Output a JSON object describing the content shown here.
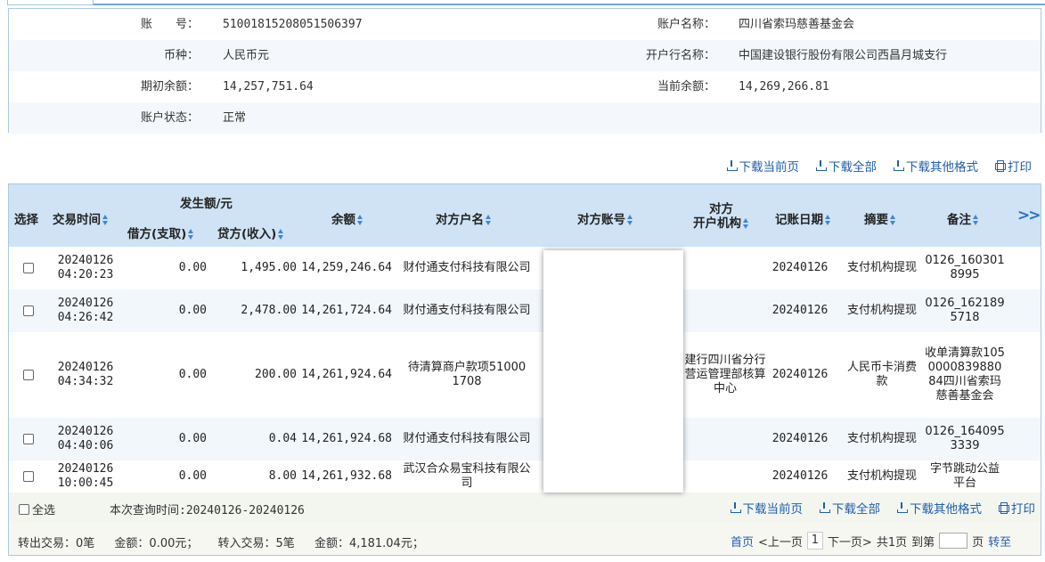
{
  "account": {
    "number_label": "账　　号：",
    "number": "51001815208051506397",
    "name_label": "账户名称：",
    "name": "四川省索玛慈善基金会",
    "currency_label": "币种：",
    "currency": "人民币元",
    "bank_label": "开户行名称：",
    "bank": "中国建设银行股份有限公司西昌月城支行",
    "opening_balance_label": "期初余额：",
    "opening_balance": "14,257,751.64",
    "current_balance_label": "当前余额：",
    "current_balance": "14,269,266.81",
    "status_label": "账户状态：",
    "status": "正常"
  },
  "actions": {
    "download_page": "下载当前页",
    "download_all": "下载全部",
    "download_other": "下载其他格式",
    "print": "打印"
  },
  "table": {
    "headers": {
      "select": "选择",
      "time": "交易时间",
      "amount_group": "发生额/元",
      "debit": "借方(支取)",
      "credit": "贷方(收入)",
      "balance": "余额",
      "counterparty_name": "对方户名",
      "counterparty_account": "对方账号",
      "counterparty_bank_line1": "对方",
      "counterparty_bank_line2": "开户机构",
      "post_date": "记账日期",
      "summary": "摘要",
      "remark": "备注",
      "more": ">>"
    },
    "rows": [
      {
        "date": "20240126",
        "time": "04:20:23",
        "debit": "0.00",
        "credit": "1,495.00",
        "balance": "14,259,246.64",
        "name": "财付通支付科技有限公司",
        "bank": "",
        "post": "20240126",
        "summary": "支付机构提现",
        "remark": "0126_1603018995"
      },
      {
        "date": "20240126",
        "time": "04:26:42",
        "debit": "0.00",
        "credit": "2,478.00",
        "balance": "14,261,724.64",
        "name": "财付通支付科技有限公司",
        "bank": "",
        "post": "20240126",
        "summary": "支付机构提现",
        "remark": "0126_1621895718"
      },
      {
        "date": "20240126",
        "time": "04:34:32",
        "debit": "0.00",
        "credit": "200.00",
        "balance": "14,261,924.64",
        "name": "待清算商户款项510001708",
        "bank": "建行四川省分行营运管理部核算中心",
        "post": "20240126",
        "summary": "人民币卡消费款",
        "remark": "收单清算款105000083988084四川省索玛慈善基金会"
      },
      {
        "date": "20240126",
        "time": "04:40:06",
        "debit": "0.00",
        "credit": "0.04",
        "balance": "14,261,924.68",
        "name": "财付通支付科技有限公司",
        "bank": "",
        "post": "20240126",
        "summary": "支付机构提现",
        "remark": "0126_1640953339"
      },
      {
        "date": "20240126",
        "time": "10:00:45",
        "debit": "0.00",
        "credit": "8.00",
        "balance": "14,261,932.68",
        "name": "武汉合众易宝科技有限公司",
        "bank": "",
        "post": "20240126",
        "summary": "支付机构提现",
        "remark": "字节跳动公益平台"
      }
    ]
  },
  "footer": {
    "select_all": "全选",
    "query_time": "本次查询时间:20240126-20240126",
    "out_count": "转出交易：0笔",
    "out_amount": "金额：0.00元；",
    "in_count": "转入交易：5笔",
    "in_amount": "金额：4,181.04元；",
    "first": "首页",
    "prev": "<上一页",
    "current_page": "1",
    "next": "下一页>",
    "total": "共1页",
    "goto_label": "到第",
    "page_unit": "页",
    "goto_btn": "转至"
  }
}
